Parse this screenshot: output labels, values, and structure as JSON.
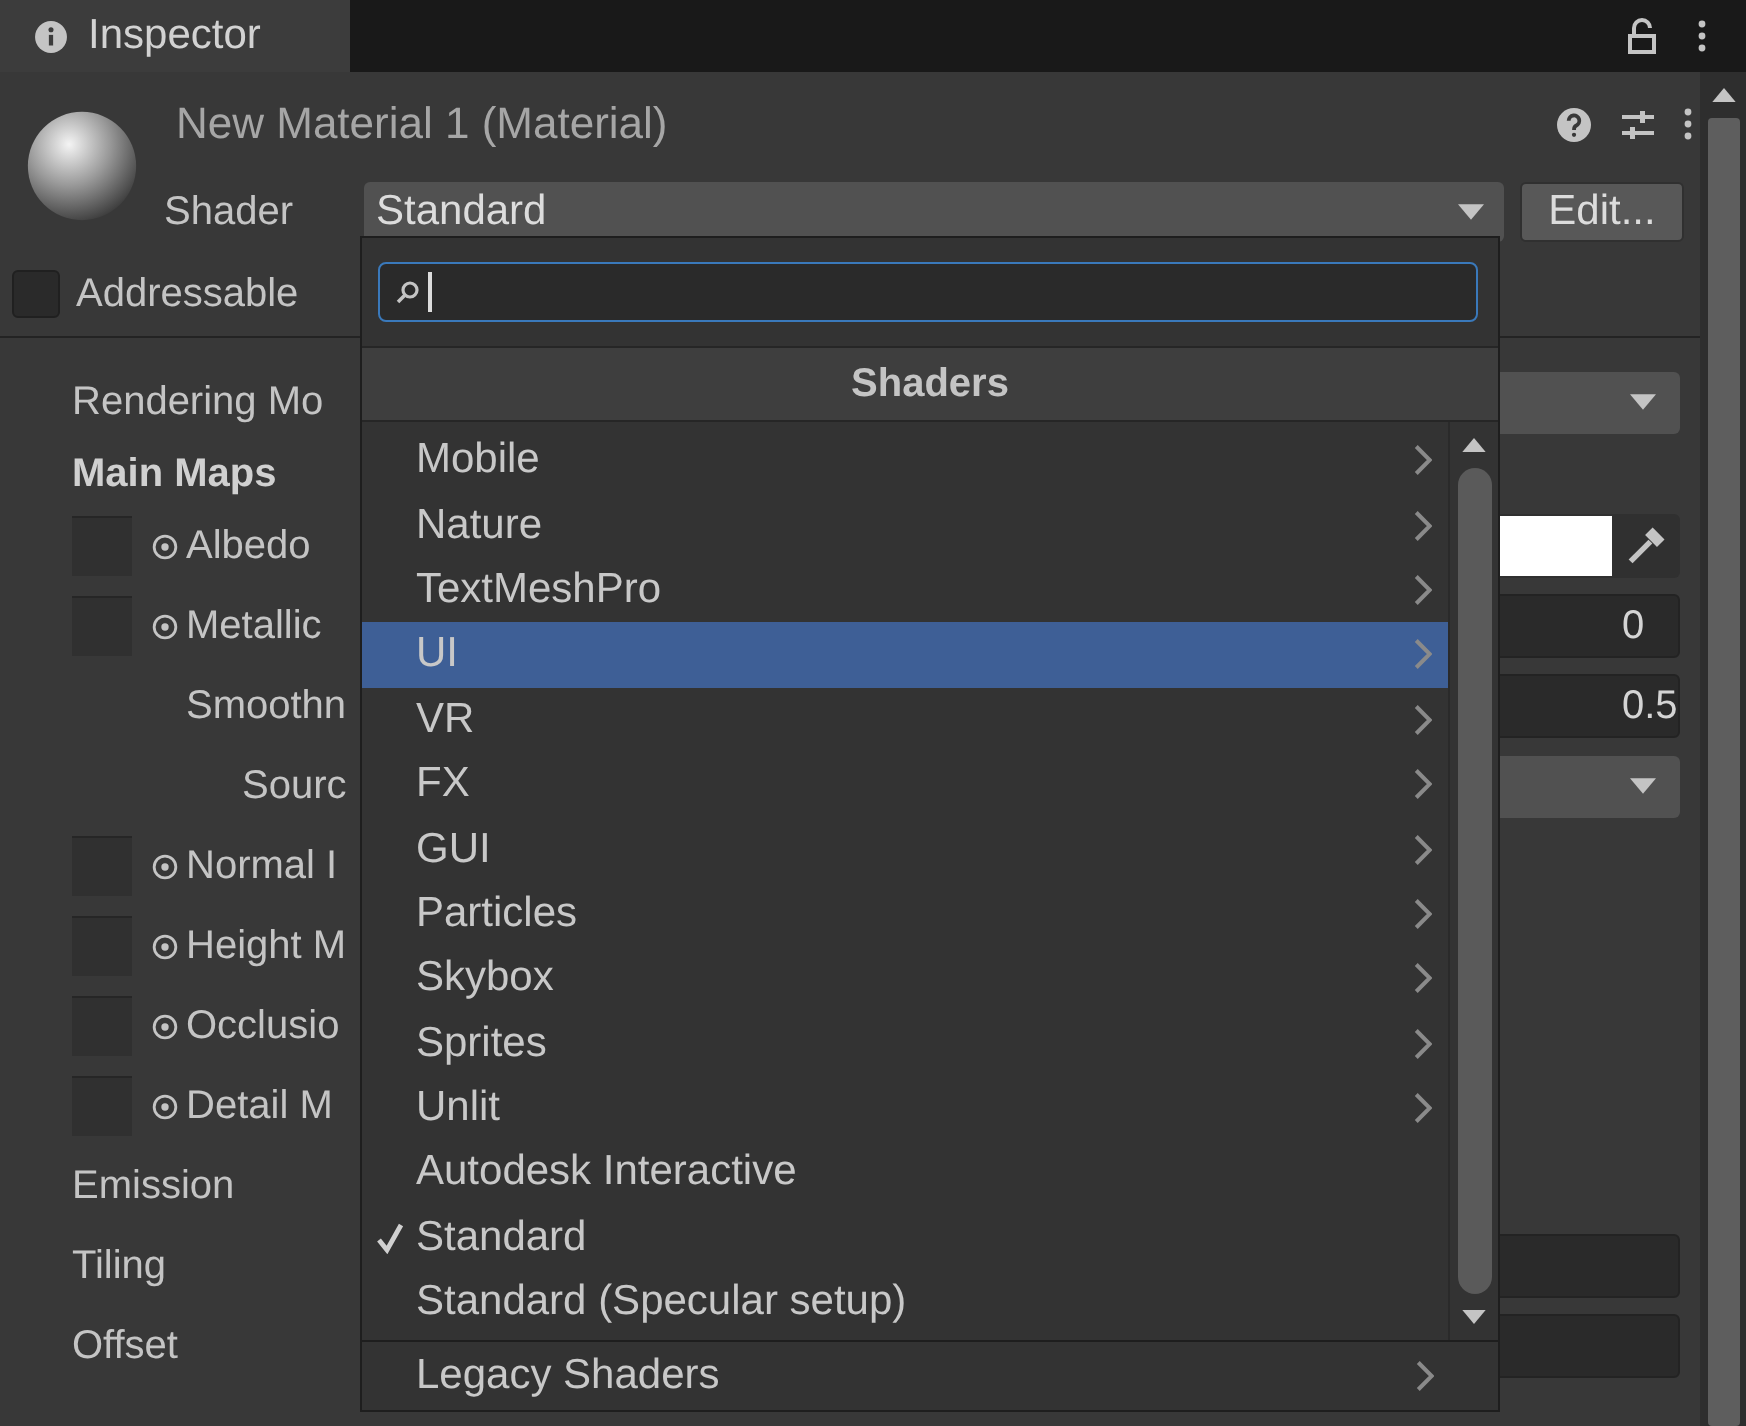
{
  "panel_tab": {
    "title": "Inspector"
  },
  "header": {
    "title": "New Material 1 (Material)",
    "shader_label": "Shader",
    "shader_value": "Standard",
    "edit_button": "Edit...",
    "addressable": {
      "label": "Addressable",
      "checked": false
    }
  },
  "properties": [
    {
      "kind": "dropdown",
      "label": "Rendering Mo"
    },
    {
      "kind": "heading",
      "label": "Main Maps"
    },
    {
      "kind": "texture_color",
      "label": "Albedo",
      "color": "#ffffff"
    },
    {
      "kind": "texture_number",
      "label": "Metallic",
      "value": "0",
      "children": [
        {
          "kind": "number",
          "label": "Smoothn",
          "value": "0.5",
          "children": [
            {
              "kind": "dropdown",
              "label": "Sourc"
            }
          ]
        }
      ]
    },
    {
      "kind": "texture",
      "label": "Normal I"
    },
    {
      "kind": "texture",
      "label": "Height M"
    },
    {
      "kind": "texture",
      "label": "Occlusio"
    },
    {
      "kind": "texture",
      "label": "Detail M"
    },
    {
      "kind": "label",
      "label": "Emission"
    },
    {
      "kind": "vector",
      "label": "Tiling"
    },
    {
      "kind": "vector",
      "label": "Offset"
    }
  ],
  "menu": {
    "title": "Shaders",
    "items": [
      {
        "label": "Mobile",
        "submenu": true,
        "selected": false,
        "checked": false
      },
      {
        "label": "Nature",
        "submenu": true,
        "selected": false,
        "checked": false
      },
      {
        "label": "TextMeshPro",
        "submenu": true,
        "selected": false,
        "checked": false
      },
      {
        "label": "UI",
        "submenu": true,
        "selected": true,
        "checked": false
      },
      {
        "label": "VR",
        "submenu": true,
        "selected": false,
        "checked": false
      },
      {
        "label": "FX",
        "submenu": true,
        "selected": false,
        "checked": false
      },
      {
        "label": "GUI",
        "submenu": true,
        "selected": false,
        "checked": false
      },
      {
        "label": "Particles",
        "submenu": true,
        "selected": false,
        "checked": false
      },
      {
        "label": "Skybox",
        "submenu": true,
        "selected": false,
        "checked": false
      },
      {
        "label": "Sprites",
        "submenu": true,
        "selected": false,
        "checked": false
      },
      {
        "label": "Unlit",
        "submenu": true,
        "selected": false,
        "checked": false
      },
      {
        "label": "Autodesk Interactive",
        "submenu": false,
        "selected": false,
        "checked": false
      },
      {
        "label": "Standard",
        "submenu": false,
        "selected": false,
        "checked": true
      },
      {
        "label": "Standard (Specular setup)",
        "submenu": false,
        "selected": false,
        "checked": false
      }
    ],
    "footer_items": [
      {
        "label": "Legacy Shaders",
        "submenu": true,
        "selected": false,
        "checked": false
      }
    ]
  }
}
